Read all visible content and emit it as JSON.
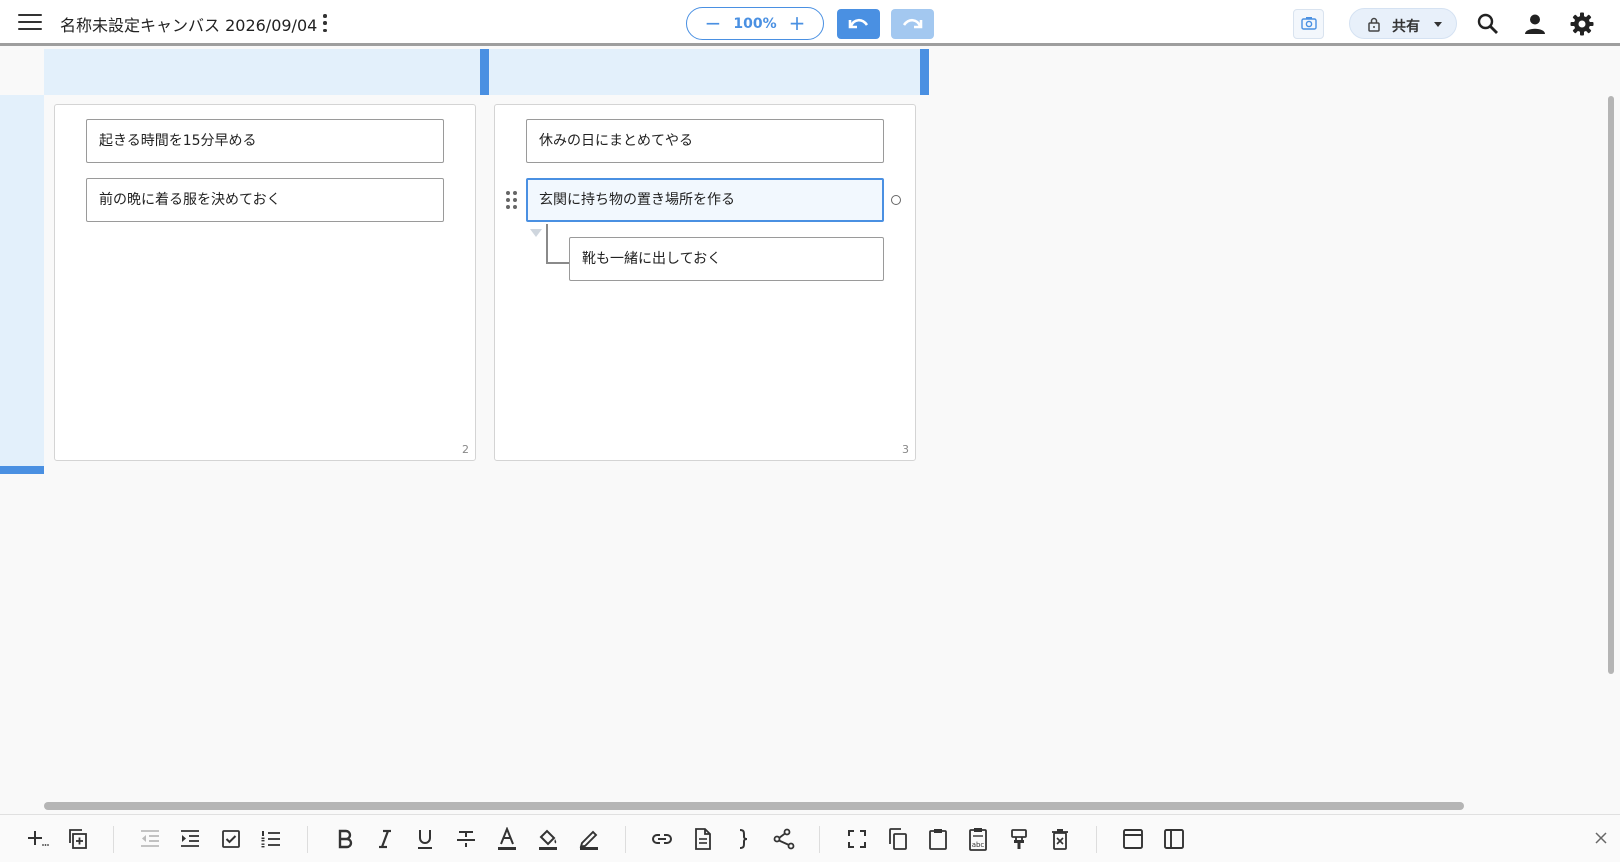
{
  "header": {
    "menu_icon": "hamburger-icon",
    "title": "名称未設定キャンバス 2026/09/04",
    "more_icon": "kebab-icon",
    "zoom": {
      "minus": "−",
      "value": "100%",
      "plus": "+"
    },
    "undo_icon": "undo-icon",
    "redo_icon": "redo-icon",
    "screenshot_icon": "camera-icon",
    "share": {
      "lock_icon": "lock-icon",
      "label": "共有"
    },
    "search_icon": "search-icon",
    "account_icon": "person-icon",
    "settings_icon": "gear-icon"
  },
  "canvas": {
    "panels": [
      {
        "number": "2",
        "cards": [
          {
            "text": "起きる時間を15分早める"
          },
          {
            "text": "前の晩に着る服を決めておく"
          }
        ]
      },
      {
        "number": "3",
        "cards": [
          {
            "text": "休みの日にまとめてやる"
          },
          {
            "text": "玄関に持ち物の置き場所を作る",
            "selected": true
          },
          {
            "text": "靴も一緒に出しておく",
            "child": true
          }
        ]
      }
    ]
  },
  "toolbar": {
    "buttons": [
      "add-icon",
      "duplicate-icon",
      "outdent-icon",
      "indent-icon",
      "checkbox-icon",
      "numbered-list-icon",
      "bold-icon",
      "italic-icon",
      "underline-icon",
      "strikethrough-icon",
      "text-color-icon",
      "fill-color-icon",
      "pen-icon",
      "link-icon",
      "document-icon",
      "brace-icon",
      "share-nodes-icon",
      "fullscreen-icon",
      "copy-icon",
      "paste-icon",
      "paste-text-icon",
      "format-painter-icon",
      "delete-icon",
      "window-icon",
      "sidebar-icon"
    ],
    "close_icon": "close-icon"
  }
}
